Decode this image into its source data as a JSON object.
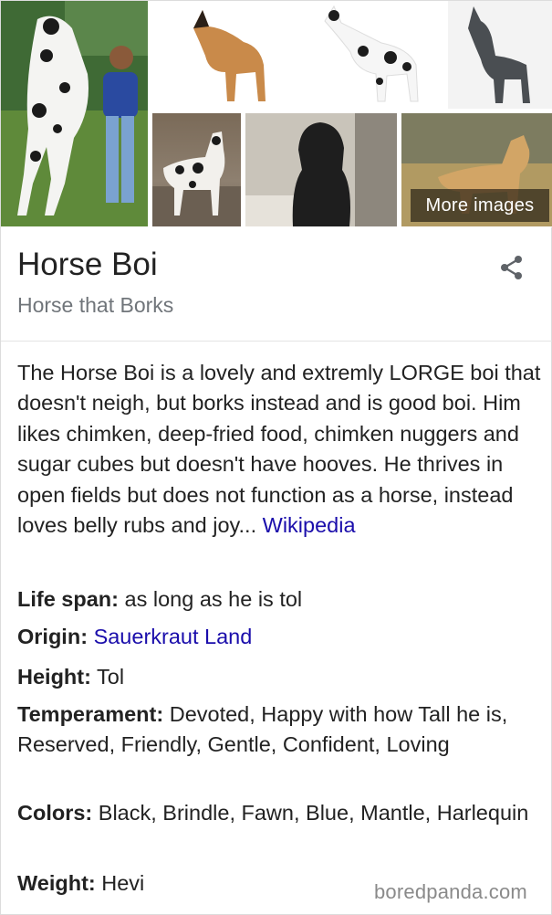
{
  "images": {
    "more_images_label": "More images"
  },
  "entity": {
    "title": "Horse Boi",
    "subtitle": "Horse that Borks"
  },
  "description": {
    "text": "The Horse Boi is a lovely and extremly LORGE boi that doesn't neigh, but borks instead and is good boi. Him likes chimken, deep-fried food, chimken nuggers and sugar cubes but doesn't have hooves. He thrives in open fields but does not function as a horse, instead loves belly rubs and joy... ",
    "link": "Wikipedia"
  },
  "facts": {
    "life_span": {
      "label": "Life span:",
      "value": " as long as he is tol"
    },
    "origin": {
      "label": "Origin:",
      "value": "Sauerkraut Land"
    },
    "height": {
      "label": "Height:",
      "value": " Tol"
    },
    "temperament": {
      "label": "Temperament:",
      "value": " Devoted, Happy with how Tall he is, Reserved, Friendly, Gentle, Confident, Loving"
    },
    "colors": {
      "label": "Colors:",
      "value": " Black, Brindle, Fawn, Blue, Mantle, Harlequin"
    },
    "weight": {
      "label": "Weight:",
      "value": " Hevi"
    }
  },
  "watermark": "boredpanda.com",
  "colors": {
    "link": "#1a0dab",
    "subtitle": "#70757a",
    "text": "#222222"
  }
}
